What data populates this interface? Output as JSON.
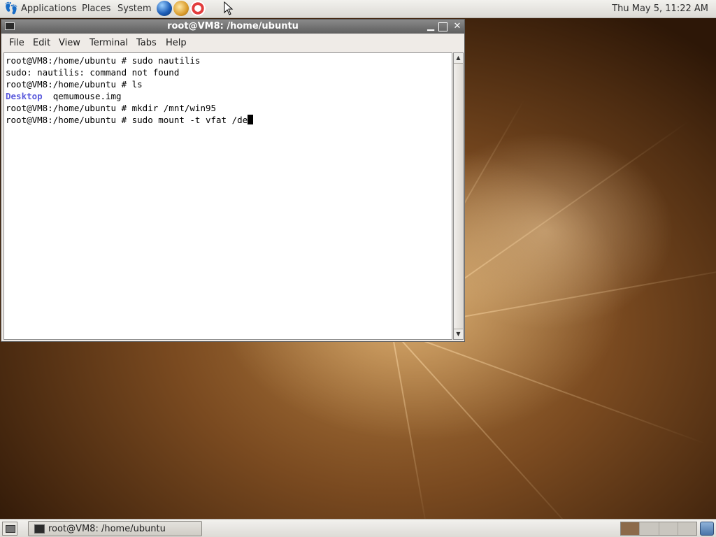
{
  "top_panel": {
    "menus": [
      "Applications",
      "Places",
      "System"
    ],
    "clock": "Thu May  5, 11:22 AM",
    "launchers": [
      "web-browser-icon",
      "mail-icon",
      "help-icon"
    ]
  },
  "window": {
    "title": "root@VM8: /home/ubuntu",
    "menu": [
      "File",
      "Edit",
      "View",
      "Terminal",
      "Tabs",
      "Help"
    ],
    "terminal": {
      "line1": "root@VM8:/home/ubuntu # sudo nautilis",
      "line2": "sudo: nautilis: command not found",
      "line3": "root@VM8:/home/ubuntu # ls",
      "line4_dir": "Desktop",
      "line4_file": "  qemumouse.img",
      "line5": "root@VM8:/home/ubuntu # mkdir /mnt/win95",
      "line6": "root@VM8:/home/ubuntu # sudo mount -t vfat /de"
    }
  },
  "bottom_panel": {
    "task_label": "root@VM8: /home/ubuntu",
    "workspaces": 4,
    "active_workspace": 1
  },
  "colors": {
    "directory": "#5a5adc",
    "titlebar": "#6e6e6e"
  }
}
